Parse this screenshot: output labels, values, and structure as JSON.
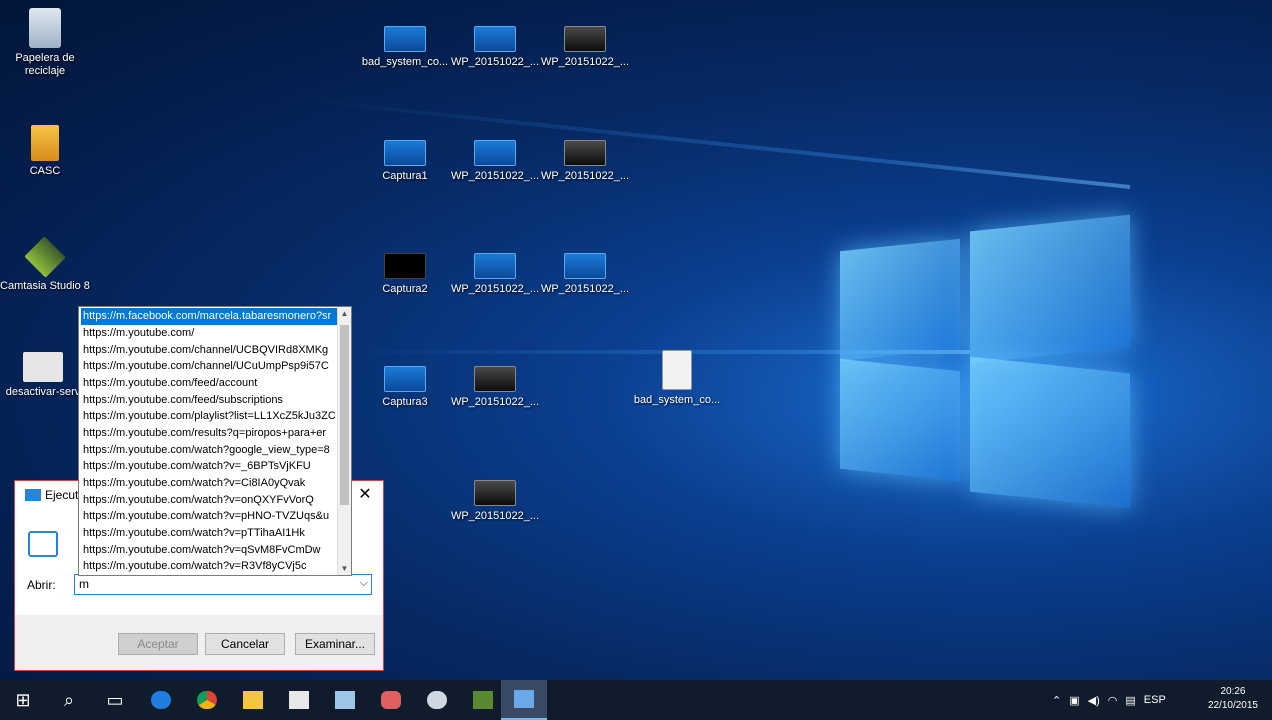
{
  "desktop": {
    "left_icons": [
      {
        "label": "Papelera de reciclaje",
        "icon": "recycle-bin-icon"
      },
      {
        "label": "CASC",
        "icon": "casc-icon"
      },
      {
        "label": "Camtasia Studio 8",
        "icon": "camtasia-icon"
      },
      {
        "label": "desactivar-serv",
        "icon": "gear-file-icon"
      }
    ],
    "grid_icons": [
      {
        "label": "bad_system_co...",
        "icon": "screenshot-icon"
      },
      {
        "label": "WP_20151022_...",
        "icon": "image-icon"
      },
      {
        "label": "WP_20151022_...",
        "icon": "image-icon"
      },
      {
        "label": "Captura1",
        "icon": "screenshot-icon"
      },
      {
        "label": "WP_20151022_...",
        "icon": "image-icon"
      },
      {
        "label": "WP_20151022_...",
        "icon": "image-icon"
      },
      {
        "label": "Captura2",
        "icon": "screenshot-icon"
      },
      {
        "label": "WP_20151022_...",
        "icon": "image-icon"
      },
      {
        "label": "WP_20151022_...",
        "icon": "image-icon"
      },
      {
        "label": "Captura3",
        "icon": "screenshot-icon"
      },
      {
        "label": "WP_20151022_...",
        "icon": "image-icon"
      },
      {
        "label": "bad_system_co...",
        "icon": "text-file-icon"
      },
      {
        "label": "WP_20151022_...",
        "icon": "image-icon"
      }
    ]
  },
  "run_dialog": {
    "title": "Ejecuta",
    "open_label": "Abrir:",
    "input_value": "m",
    "ok_label": "Aceptar",
    "cancel_label": "Cancelar",
    "browse_label": "Examinar..."
  },
  "autocomplete": {
    "items": [
      "https://m.facebook.com/marcela.tabaresmonero?sr",
      "https://m.youtube.com/",
      "https://m.youtube.com/channel/UCBQVIRd8XMKg",
      "https://m.youtube.com/channel/UCuUmpPsp9i57C",
      "https://m.youtube.com/feed/account",
      "https://m.youtube.com/feed/subscriptions",
      "https://m.youtube.com/playlist?list=LL1XcZ5kJu3ZC",
      "https://m.youtube.com/results?q=piropos+para+er",
      "https://m.youtube.com/watch?google_view_type=8",
      "https://m.youtube.com/watch?v=_6BPTsVjKFU",
      "https://m.youtube.com/watch?v=Ci8IA0yQvak",
      "https://m.youtube.com/watch?v=onQXYFvVorQ",
      "https://m.youtube.com/watch?v=pHNO-TVZUqs&u",
      "https://m.youtube.com/watch?v=pTTihaAI1Hk",
      "https://m.youtube.com/watch?v=qSvM8FvCmDw",
      "https://m.youtube.com/watch?v=R3Vf8yCVj5c"
    ],
    "selected_index": 0
  },
  "taskbar": {
    "apps": [
      "start-icon",
      "search-icon",
      "task-view-icon",
      "edge-icon",
      "chrome-icon",
      "file-explorer-icon",
      "store-icon",
      "notepad-icon",
      "paint-icon",
      "settings-icon",
      "camtasia-icon",
      "run-icon"
    ],
    "language": "ESP",
    "time": "20:26",
    "date": "22/10/2015"
  },
  "colors": {
    "accent": "#0078d7",
    "taskbar_bg": "#101b2b",
    "dialog_border": "#d04545"
  }
}
